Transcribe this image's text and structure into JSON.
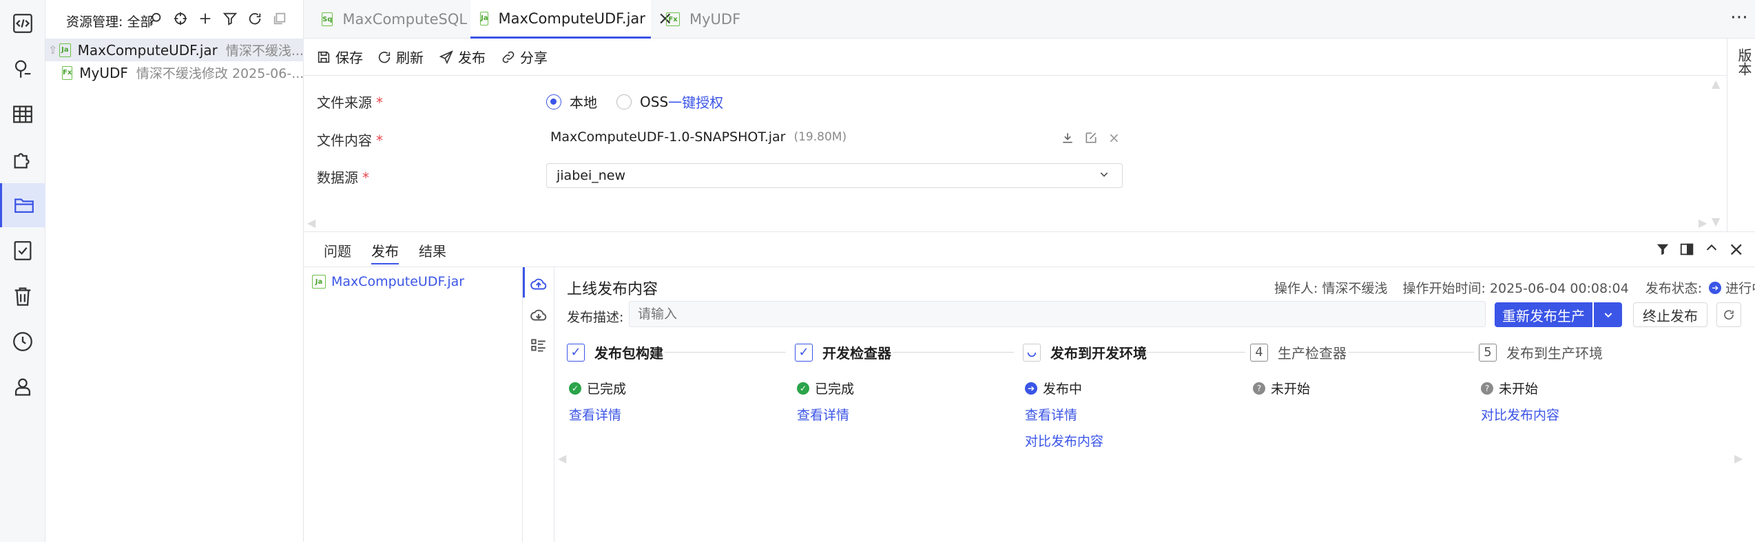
{
  "explorer": {
    "title": "资源管理: 全部",
    "items": [
      {
        "type": "Ja",
        "name": "MaxComputeUDF.jar",
        "meta": "情深不缓浅..."
      },
      {
        "type": "Fx",
        "name": "MyUDF",
        "meta": "情深不缓浅修改 2025-06-..."
      }
    ]
  },
  "tabs": [
    {
      "type": "Sq",
      "label": "MaxComputeSQL"
    },
    {
      "type": "Ja",
      "label": "MaxComputeUDF.jar"
    },
    {
      "type": "Fx",
      "label": "MyUDF"
    }
  ],
  "toolbar": {
    "save": "保存",
    "refresh": "刷新",
    "publish": "发布",
    "share": "分享"
  },
  "version_label": "版本",
  "form": {
    "source_label": "文件来源",
    "source_local": "本地",
    "source_oss": "OSS",
    "oss_auth_link": "一键授权",
    "content_label": "文件内容",
    "file_name": "MaxComputeUDF-1.0-SNAPSHOT.jar",
    "file_size": "(19.80M)",
    "datasource_label": "数据源",
    "datasource_value": "jiabei_new"
  },
  "panel": {
    "tabs": [
      "问题",
      "发布",
      "结果"
    ],
    "list_item": "MaxComputeUDF.jar",
    "title": "上线发布内容",
    "operator": "操作人: 情深不缓浅",
    "start_time": "操作开始时间: 2025-06-04 00:08:04",
    "status_label": "发布状态:",
    "status_value": "进行中",
    "desc_label": "发布描述:",
    "desc_placeholder": "请输入",
    "republish": "重新发布生产",
    "stop": "终止发布",
    "steps": [
      {
        "marker": "✓",
        "title": "发布包构建",
        "status": "已完成",
        "links": [
          "查看详情"
        ]
      },
      {
        "marker": "✓",
        "title": "开发检查器",
        "status": "已完成",
        "links": [
          "查看详情"
        ]
      },
      {
        "marker": "",
        "title": "发布到开发环境",
        "status": "发布中",
        "links": [
          "查看详情",
          "对比发布内容"
        ]
      },
      {
        "marker": "4",
        "title": "生产检查器",
        "status": "未开始",
        "links": []
      },
      {
        "marker": "5",
        "title": "发布到生产环境",
        "status": "未开始",
        "links": [
          "对比发布内容"
        ]
      }
    ]
  },
  "colors": {
    "accent": "#3b55e6",
    "done": "#2ba44a",
    "pending": "#8a8a8a"
  }
}
